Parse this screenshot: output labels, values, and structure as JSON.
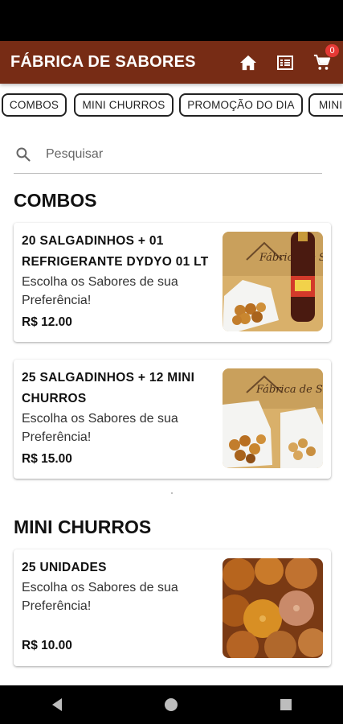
{
  "app_bar": {
    "title": "FÁBRICA DE SABORES",
    "cart_count": "0",
    "bg_color": "#772c15",
    "icons": [
      "home-icon",
      "menu-list-icon",
      "cart-icon"
    ]
  },
  "categories": [
    "COMBOS",
    "MINI CHURROS",
    "PROMOÇÃO DO DIA",
    "MINI"
  ],
  "search": {
    "placeholder": "Pesquisar"
  },
  "sections": [
    {
      "title": "COMBOS",
      "products": [
        {
          "name": "20 SALGADINHOS + 01 REFRIGERANTE DYDYO 01 LT",
          "description": "Escolha os Sabores de sua Preferência!",
          "price": "R$ 12.00",
          "image_logo": "Fábrica de Sabores"
        },
        {
          "name": "25 SALGADINHOS + 12 MINI CHURROS",
          "description": "Escolha os Sabores de sua Preferência!",
          "price": "R$ 15.00",
          "image_logo": "Fábrica de Sabores"
        }
      ]
    },
    {
      "title": "MINI CHURROS",
      "products": [
        {
          "name": "25 UNIDADES",
          "description": "Escolha os Sabores de sua Preferência!",
          "price": "R$ 10.00"
        }
      ]
    }
  ],
  "nav": {
    "icons": [
      "back-icon",
      "home-circle-icon",
      "recents-icon"
    ]
  }
}
